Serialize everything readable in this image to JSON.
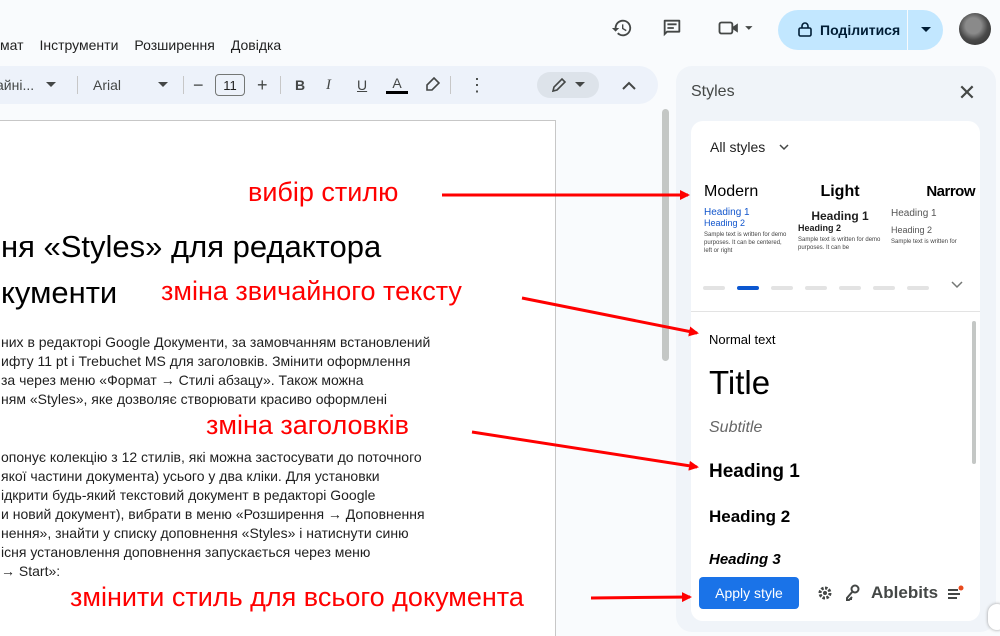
{
  "menu": [
    "мат",
    "Інструменти",
    "Розширення",
    "Довідка"
  ],
  "header": {
    "share_label": "Поділитися",
    "icons": [
      "history-icon",
      "comment-icon",
      "video-call-icon",
      "lock-icon",
      "avatar"
    ]
  },
  "toolbar": {
    "style_value": "айні...",
    "font_value": "Arial",
    "font_size": "11",
    "minus": "−",
    "plus": "+",
    "bold": "B",
    "italic": "I",
    "underline": "U",
    "textcolor": "A",
    "more": "⋮"
  },
  "document": {
    "title_line1": "ня «Styles» для редактора",
    "title_line2": "кументи",
    "para1": [
      "них в редакторі Google Документи, за замовчанням встановлений",
      "ифту 11 pt і Trebuchet MS для заголовків. Змінити оформлення",
      "за через меню «Формат → Стилі абзацу». Також можна",
      "ням «Styles», яке дозволяє створювати красиво оформлені"
    ],
    "para2": [
      "опонує колекцію з 12 стилів, які можна застосувати до поточного",
      "якої частини документа) усього у два кліки. Для установки",
      "ідкрити будь-який текстовий документ в редакторі Google",
      "и новий документ), вибрати в меню «Розширення → Доповнення",
      "нення», знайти у списку доповнення «Styles» і натиснути синю",
      "існя установлення доповнення запускається через меню",
      "→ Start»:"
    ]
  },
  "panel": {
    "title": "Styles",
    "filter": "All styles",
    "themes": [
      {
        "name": "Modern",
        "h1": "Heading 1",
        "h2": "Heading 2",
        "sample": "Sample text is written for demo purposes. It can be centered, left or right"
      },
      {
        "name": "Light",
        "h1": "Heading 1",
        "h2": "Heading 2",
        "sample": "Sample text is written for demo purposes. It can be"
      },
      {
        "name": "Narrow",
        "h1": "Heading 1",
        "h2": "Heading 2",
        "sample": "Sample text is written for"
      }
    ],
    "styles": {
      "normal": "Normal text",
      "title": "Title",
      "subtitle": "Subtitle",
      "h1": "Heading 1",
      "h2": "Heading 2",
      "h3": "Heading 3"
    },
    "apply_label": "Apply style",
    "brand": "Ablebits"
  },
  "annotations": {
    "choose_style": "вибір стилю",
    "normal_text": "зміна звичайного тексту",
    "headings": "зміна заголовків",
    "whole_doc": "змінити стиль для всього документа"
  },
  "colors": {
    "annotation": "#ff0000",
    "accent": "#1a73e8",
    "share_bg": "#c2e7ff",
    "heading_blue": "#1155cc"
  }
}
